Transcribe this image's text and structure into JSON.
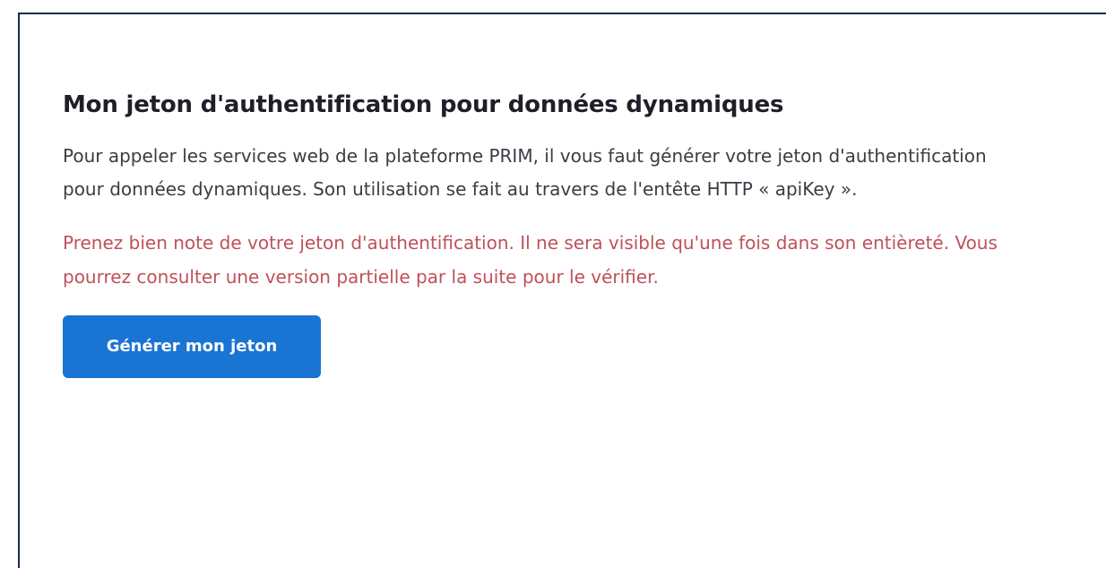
{
  "token_section": {
    "title": "Mon jeton d'authentification pour données dynamiques",
    "description": "Pour appeler les services web de la plateforme PRIM, il vous faut générer votre jeton d'authentification pour données dynamiques. Son utilisation se fait au travers de l'entête HTTP « apiKey ».",
    "warning": "Prenez bien note de votre jeton d'authentification. Il ne sera visible qu'une fois dans son entièreté. Vous pourrez consulter une version partielle par la suite pour le vérifier.",
    "generate_button_label": "Générer mon jeton"
  },
  "colors": {
    "accent": "#1a74d3",
    "warning_text": "#c0505a",
    "border": "#1d2a4d"
  }
}
